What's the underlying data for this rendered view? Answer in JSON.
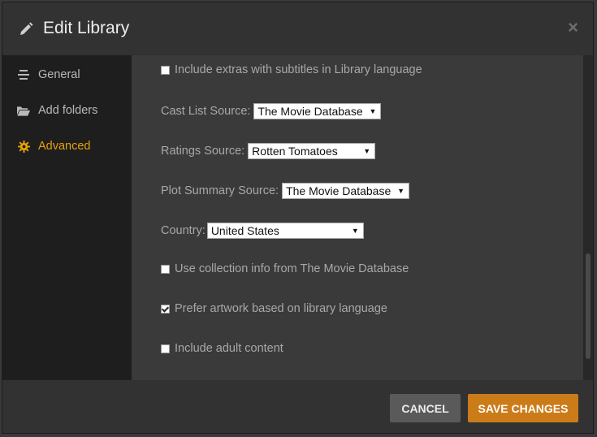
{
  "dialog": {
    "title": "Edit Library",
    "close_symbol": "×"
  },
  "sidebar": {
    "items": [
      {
        "label": "General",
        "icon": "list-icon",
        "active": false
      },
      {
        "label": "Add folders",
        "icon": "folder-icon",
        "active": false
      },
      {
        "label": "Advanced",
        "icon": "gear-icon",
        "active": true
      }
    ]
  },
  "advanced": {
    "include_extras": {
      "label": "Include extras with subtitles in Library language",
      "checked": false
    },
    "cast_list_source": {
      "label": "Cast List Source:",
      "value": "The Movie Database"
    },
    "ratings_source": {
      "label": "Ratings Source:",
      "value": "Rotten Tomatoes"
    },
    "plot_summary_source": {
      "label": "Plot Summary Source:",
      "value": "The Movie Database"
    },
    "country": {
      "label": "Country:",
      "value": "United States"
    },
    "collection_info": {
      "label": "Use collection info from The Movie Database",
      "checked": false
    },
    "prefer_artwork": {
      "label": "Prefer artwork based on library language",
      "checked": true
    },
    "adult_content": {
      "label": "Include adult content",
      "checked": false
    }
  },
  "footer": {
    "cancel_label": "CANCEL",
    "save_label": "SAVE CHANGES"
  },
  "colors": {
    "accent": "#e5a00d",
    "save_button": "#cc7b19",
    "cancel_button": "#5a5a5a"
  }
}
